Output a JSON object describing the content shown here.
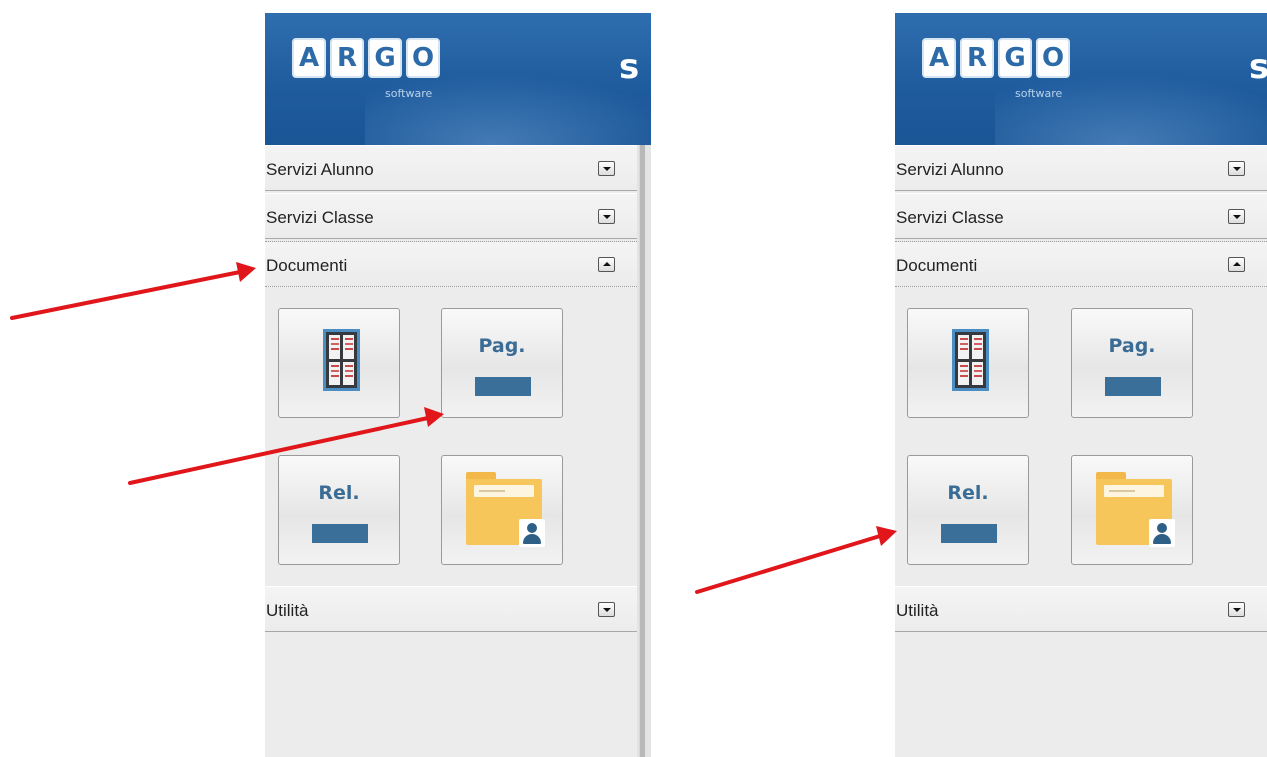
{
  "header": {
    "logo_letters": [
      "A",
      "R",
      "G",
      "O"
    ],
    "logo_subtitle": "software",
    "title_fragment": "s"
  },
  "sidebar": {
    "sections": [
      {
        "label": "Servizi Alunno",
        "state": "collapsed"
      },
      {
        "label": "Servizi Classe",
        "state": "collapsed"
      },
      {
        "label": "Documenti",
        "state": "expanded"
      },
      {
        "label": "Utilità",
        "state": "collapsed"
      }
    ],
    "documenti_tiles": [
      {
        "icon": "bulletin-board-grid-icon",
        "label": ""
      },
      {
        "icon": "document-tile-icon",
        "label": "Pag."
      },
      {
        "icon": "document-tile-icon",
        "label": "Rel."
      },
      {
        "icon": "user-folder-icon",
        "label": ""
      }
    ]
  },
  "annotations": {
    "arrow_color": "#e0161b"
  },
  "colors": {
    "header_blue": "#1f5c9e",
    "tile_text": "#3a6c95",
    "tile_bar": "#3a6f9a",
    "folder": "#f7c65a",
    "panel_bg": "#ececec"
  }
}
